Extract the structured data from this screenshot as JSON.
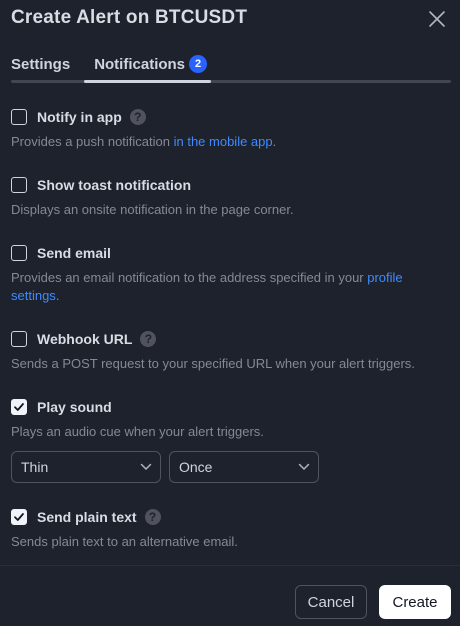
{
  "dialog": {
    "title": "Create Alert on BTCUSDT",
    "close_icon": "close-icon"
  },
  "tabs": [
    {
      "label": "Settings",
      "active": false
    },
    {
      "label": "Notifications",
      "active": true,
      "badge": "2"
    }
  ],
  "options": {
    "notify_app": {
      "label": "Notify in app",
      "checked": false,
      "help": "?",
      "desc_before": "Provides a push notification ",
      "desc_link": "in the mobile app",
      "desc_after": "."
    },
    "toast": {
      "label": "Show toast notification",
      "checked": false,
      "desc": "Displays an onsite notification in the page corner."
    },
    "email": {
      "label": "Send email",
      "checked": false,
      "desc_before": "Provides an email notification to the address specified in your ",
      "desc_link": "profile settings",
      "desc_after": "."
    },
    "webhook": {
      "label": "Webhook URL",
      "checked": false,
      "help": "?",
      "desc": "Sends a POST request to your specified URL when your alert triggers."
    },
    "sound": {
      "label": "Play sound",
      "checked": true,
      "desc": "Plays an audio cue when your alert triggers.",
      "sound_select": "Thin",
      "repeat_select": "Once"
    },
    "plain_text": {
      "label": "Send plain text",
      "checked": true,
      "help": "?",
      "desc": "Sends plain text to an alternative email."
    }
  },
  "footer": {
    "cancel_label": "Cancel",
    "create_label": "Create"
  },
  "colors": {
    "background": "#1e222d",
    "accent": "#2962ff",
    "link": "#3d8bff"
  }
}
